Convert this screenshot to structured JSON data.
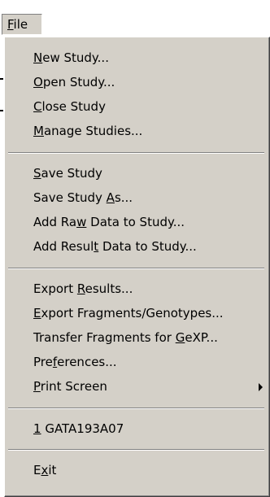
{
  "menu_title": {
    "mnemonic": "F",
    "rest": "ile"
  },
  "items": [
    {
      "pre": "",
      "mn": "N",
      "post": "ew Study..."
    },
    {
      "pre": "",
      "mn": "O",
      "post": "pen Study..."
    },
    {
      "pre": "",
      "mn": "C",
      "post": "lose Study"
    },
    {
      "pre": "",
      "mn": "M",
      "post": "anage Studies..."
    },
    {
      "pre": "",
      "mn": "S",
      "post": "ave Study"
    },
    {
      "pre": "Save Study ",
      "mn": "A",
      "post": "s..."
    },
    {
      "pre": "Add Ra",
      "mn": "w",
      "post": " Data to Study..."
    },
    {
      "pre": "Add Resul",
      "mn": "t",
      "post": " Data to Study..."
    },
    {
      "pre": "Export ",
      "mn": "R",
      "post": "esults..."
    },
    {
      "pre": "",
      "mn": "E",
      "post": "xport Fragments/Genotypes..."
    },
    {
      "pre": "Transfer Fragments for ",
      "mn": "G",
      "post": "eXP..."
    },
    {
      "pre": "Pre",
      "mn": "f",
      "post": "erences..."
    },
    {
      "pre": "",
      "mn": "P",
      "post": "rint Screen"
    },
    {
      "pre": "",
      "mn": "1",
      "post": " GATA193A07"
    },
    {
      "pre": "E",
      "mn": "x",
      "post": "it"
    }
  ]
}
